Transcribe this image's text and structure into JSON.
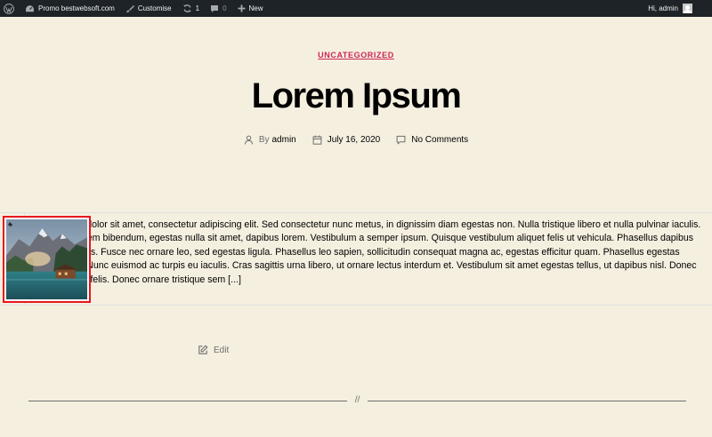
{
  "adminbar": {
    "site_name": "Promo bestwebsoft.com",
    "customise": "Customise",
    "updates_count": "1",
    "comments_count": "0",
    "new_label": "New",
    "greeting": "Hi, admin"
  },
  "post": {
    "category": "UNCATEGORIZED",
    "title": "Lorem Ipsum",
    "author_prefix": "By",
    "author": "admin",
    "date": "July 16, 2020",
    "comments": "No Comments",
    "excerpt": "Lorem ipsum dolor sit amet, consectetur adipiscing elit. Sed consectetur nunc metus, in dignissim diam egestas non. Nulla tristique libero et nulla pulvinar iaculis. Praesent ac sem bibendum, egestas nulla sit amet, dapibus lorem. Vestibulum a semper ipsum. Quisque vestibulum aliquet felis ut vehicula. Phasellus dapibus ornare convallis. Fusce nec ornare leo, sed egestas ligula. Phasellus leo sapien, sollicitudin consequat magna ac, egestas efficitur quam. Phasellus egestas mollis mattis. Nunc euismod ac turpis eu iaculis. Cras sagittis urna libero, ut ornare lectus interdum et. Vestibulum sit amet egestas tellus, ut dapibus nisl. Donec sed venenatis felis. Donec ornare tristique sem [...]",
    "edit_label": "Edit"
  },
  "separator": "//",
  "colors": {
    "background": "#f5efe0",
    "adminbar": "#1d2327",
    "accent": "#cd2653",
    "highlight_border": "#e8161d"
  }
}
